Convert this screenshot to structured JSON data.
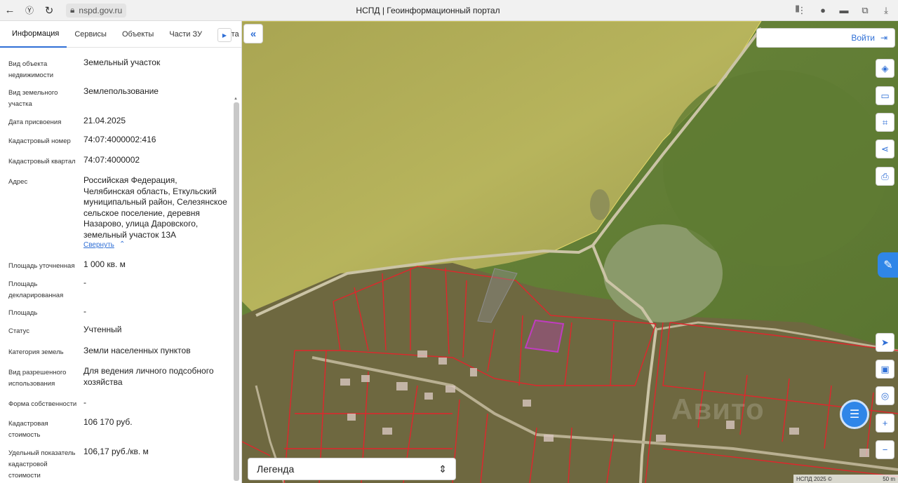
{
  "browser": {
    "url": "nspd.gov.ru",
    "title": "НСПД | Геоинформационный портал",
    "back_icon": "back-arrow-icon",
    "reload_icon": "reload-icon"
  },
  "panel": {
    "tabs": [
      {
        "label": "Информация"
      },
      {
        "label": "Сервисы"
      },
      {
        "label": "Объекты"
      },
      {
        "label": "Части ЗУ"
      },
      {
        "label": "Соста"
      }
    ],
    "rows": [
      {
        "label": "Вид объекта недвижимости",
        "value": "Земельный участок"
      },
      {
        "label": "Вид земельного участка",
        "value": "Землепользование"
      },
      {
        "label": "Дата присвоения",
        "value": "21.04.2025"
      },
      {
        "label": "Кадастровый номер",
        "value": "74:07:4000002:416"
      },
      {
        "label": "Кадастровый квартал",
        "value": "74:07:4000002"
      },
      {
        "label": "Адрес",
        "value": "Российская Федерация, Челябинская область, Еткульский муниципальный район, Селезянское сельское поселение, деревня Назарово, улица Даровского, земельный участок 13А"
      },
      {
        "label": "Площадь уточненная",
        "value": "1 000 кв. м"
      },
      {
        "label": "Площадь декларированная",
        "value": "-"
      },
      {
        "label": "Площадь",
        "value": "-"
      },
      {
        "label": "Статус",
        "value": "Учтенный"
      },
      {
        "label": "Категория земель",
        "value": "Земли населенных пунктов"
      },
      {
        "label": "Вид разрешенного использования",
        "value": "Для ведения личного подсобного хозяйства"
      },
      {
        "label": "Форма собственности",
        "value": "-"
      },
      {
        "label": "Кадастровая стоимость",
        "value": "106 170 руб."
      },
      {
        "label": "Удельный показатель кадастровой стоимости",
        "value": "106,17 руб./кв. м"
      }
    ],
    "collapse_link": "Свернуть"
  },
  "map": {
    "login_label": "Войти",
    "legend_label": "Легенда",
    "scale_left": "НСПД 2025 ©",
    "scale_right": "50 m",
    "watermark": "Авито",
    "colors": {
      "accent": "#2f6fd6",
      "parcel_border": "#e0262c",
      "selected_parcel": "#c03cc0"
    }
  }
}
